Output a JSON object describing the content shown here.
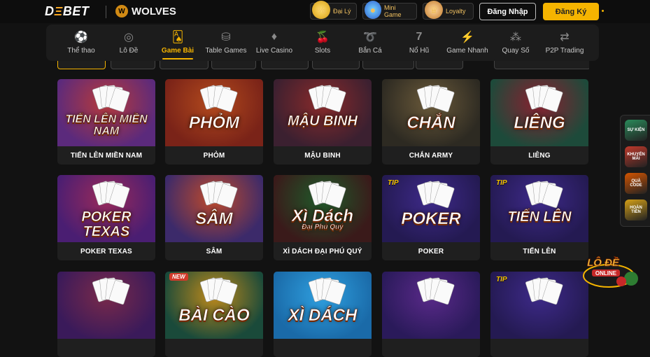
{
  "header": {
    "logo": {
      "part1": "D",
      "accent": "Ξ",
      "part2": "BET"
    },
    "partner": "WOLVES",
    "promos": [
      {
        "label": "Đại Lý",
        "icon": "percent-coin-icon",
        "color": "#f4c542"
      },
      {
        "label": "Mini Game",
        "icon": "ball-icon",
        "color": "#3f8ff0"
      },
      {
        "label": "Loyalty",
        "icon": "crown-icon",
        "color": "#d69b4a"
      }
    ],
    "login_label": "Đăng Nhập",
    "register_label": "Đăng Ký"
  },
  "categories": [
    {
      "label": "Thể thao",
      "icon": "soccer-ball-icon",
      "active": false
    },
    {
      "label": "Lô Đề",
      "icon": "lottery-ball-icon",
      "active": false
    },
    {
      "label": "Game Bài",
      "icon": "playing-cards-icon",
      "active": true
    },
    {
      "label": "Table Games",
      "icon": "chip-icon",
      "active": false
    },
    {
      "label": "Live Casino",
      "icon": "diamond-suit-icon",
      "active": false
    },
    {
      "label": "Slots",
      "icon": "cherry-icon",
      "active": false
    },
    {
      "label": "Bắn Cá",
      "icon": "fish-icon",
      "active": false
    },
    {
      "label": "Nổ Hũ",
      "icon": "seven-icon",
      "active": false
    },
    {
      "label": "Game Nhanh",
      "icon": "lightning-icon",
      "active": false
    },
    {
      "label": "Quay Số",
      "icon": "number-balls-icon",
      "active": false
    },
    {
      "label": "P2P Trading",
      "icon": "p2p-icon",
      "active": false
    }
  ],
  "games": [
    {
      "label": "TIẾN LÊN MIỀN NAM",
      "art_title": "TIẾN LÊN MIỀN NAM",
      "badge": "",
      "bg": "#5b2a7c",
      "bg2": "#b83a3a"
    },
    {
      "label": "PHỎM",
      "art_title": "PHỎM",
      "badge": "",
      "bg": "#7a2318",
      "bg2": "#b34a1d"
    },
    {
      "label": "MẬU BINH",
      "art_title": "MẬU BINH",
      "badge": "",
      "bg": "#3b2030",
      "bg2": "#8a2a2a"
    },
    {
      "label": "CHẮN ARMY",
      "art_title": "CHẮN",
      "badge": "",
      "bg": "#2d2a22",
      "bg2": "#6b5a3a"
    },
    {
      "label": "LIÊNG",
      "art_title": "LIÊNG",
      "badge": "",
      "bg": "#1d4a3a",
      "bg2": "#8a2030"
    },
    {
      "label": "POKER TEXAS",
      "art_title": "POKER TEXAS",
      "badge": "",
      "bg": "#4a1e72",
      "bg2": "#9a2a5a"
    },
    {
      "label": "SÂM",
      "art_title": "SÂM",
      "badge": "",
      "bg": "#3c2a6a",
      "bg2": "#c04a2a"
    },
    {
      "label": "XÌ DÁCH ĐẠI PHÚ QUÝ",
      "art_title": "Xì Dách",
      "art_sub": "Đại Phú Quý",
      "badge": "",
      "bg": "#3a1a1a",
      "bg2": "#1f5a2a"
    },
    {
      "label": "POKER",
      "art_title": "POKER",
      "badge": "TIP",
      "bg": "#241a52",
      "bg2": "#3e2a8a"
    },
    {
      "label": "TIẾN LÊN",
      "art_title": "TIẾN LÊN",
      "badge": "TIP",
      "bg": "#241a52",
      "bg2": "#3e2a8a"
    },
    {
      "label": "",
      "art_title": "",
      "badge": "",
      "bg": "#3a1a5a",
      "bg2": "#7a2a4a"
    },
    {
      "label": "",
      "art_title": "BÀI CÀO",
      "badge": "NEW",
      "bg": "#1a4a3a",
      "bg2": "#c08a1a"
    },
    {
      "label": "",
      "art_title": "XÌ DÁCH",
      "badge": "",
      "bg": "#1a6aa8",
      "bg2": "#2fa0e0"
    },
    {
      "label": "",
      "art_title": "",
      "badge": "",
      "bg": "#2a1a5a",
      "bg2": "#5a2a8a"
    },
    {
      "label": "",
      "art_title": "",
      "badge": "TIP",
      "bg": "#241a52",
      "bg2": "#3e2a8a"
    }
  ],
  "side_float": [
    {
      "label": "SỰ KIỆN",
      "icon": "event-icon",
      "color": "#2a8a5a"
    },
    {
      "label": "KHUYẾN MÃI",
      "icon": "promo-icon",
      "color": "#c0392b"
    },
    {
      "label": "QUÀ CODE",
      "icon": "gift-code-icon",
      "color": "#d35400"
    },
    {
      "label": "HOÀN TIỀN",
      "icon": "cashback-icon",
      "color": "#d4a017"
    }
  ],
  "lode_widget": {
    "title": "LÔ ĐỀ",
    "sub": "ONLINE"
  }
}
